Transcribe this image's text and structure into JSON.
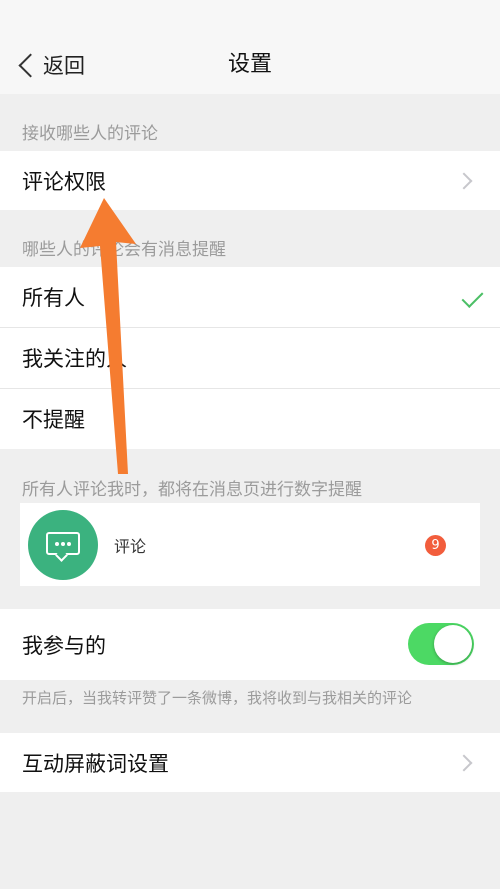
{
  "nav": {
    "back_label": "返回",
    "title": "设置"
  },
  "sections": {
    "receive_from": "接收哪些人的评论",
    "notify_who": "哪些人的评论会有消息提醒",
    "preview_hint": "所有人评论我时，都将在消息页进行数字提醒"
  },
  "rows": {
    "comment_permission": "评论权限",
    "everyone": "所有人",
    "following": "我关注的人",
    "no_notify": "不提醒",
    "participated": "我参与的",
    "block_words": "互动屏蔽词设置"
  },
  "preview": {
    "label": "评论",
    "badge": "9"
  },
  "participated_toggle": {
    "on": true
  },
  "note": "开启后，当我转评赞了一条微博，我将收到与我相关的评论",
  "colors": {
    "accent_green": "#4cd964",
    "check_green": "#4cbf66",
    "badge_red": "#f25d3c",
    "arrow_orange": "#f57c30"
  }
}
